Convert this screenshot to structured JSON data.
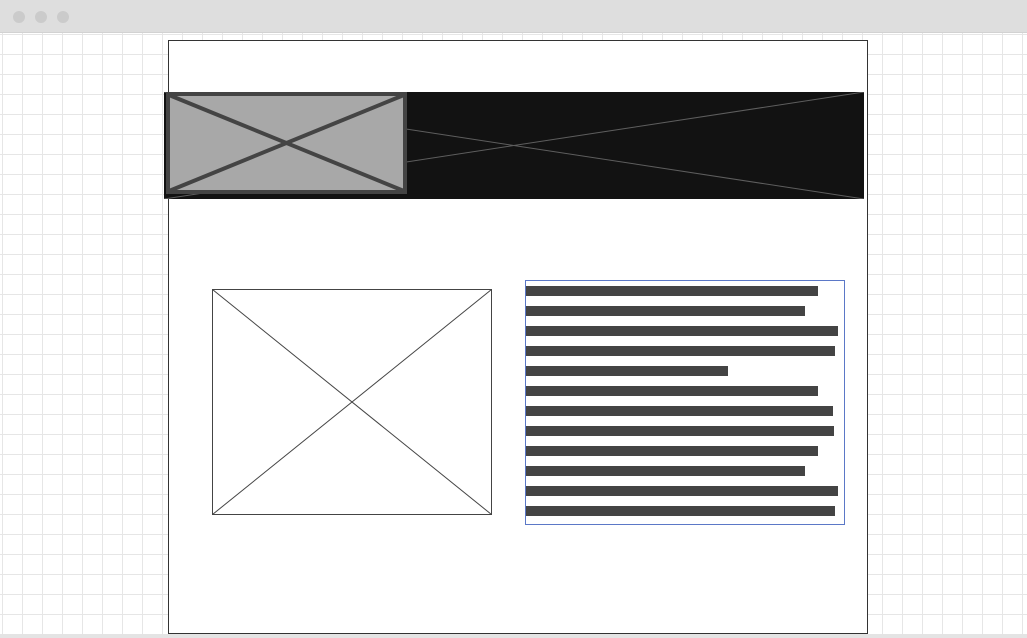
{
  "window": {
    "buttons": [
      "close-dot",
      "minimize-dot",
      "maximize-dot"
    ]
  },
  "colors": {
    "banner_background": "#121212",
    "banner_image_fill": "#a8a8a8",
    "text_line_fill": "#444444",
    "selection_outline": "#5b78c7",
    "grid_line": "#e6e6e6"
  },
  "text_block": {
    "line_count": 12
  }
}
